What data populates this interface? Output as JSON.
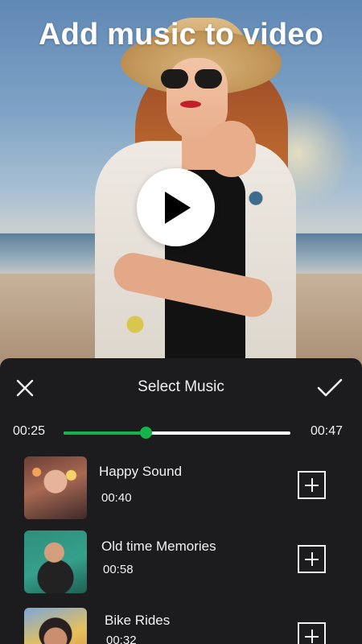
{
  "video_preview": {
    "headline": "Add music to video",
    "play_icon": "play-icon"
  },
  "music_sheet": {
    "title": "Select Music",
    "close_icon": "close-icon",
    "confirm_icon": "checkmark-icon",
    "timeline": {
      "start_time": "00:25",
      "end_time": "00:47",
      "progress_fraction": 0.36,
      "accent_color": "#17b34a"
    },
    "tracks": [
      {
        "title": "Happy Sound",
        "duration": "00:40",
        "add_icon": "plus-icon"
      },
      {
        "title": "Old time Memories",
        "duration": "00:58",
        "add_icon": "plus-icon"
      },
      {
        "title": "Bike Rides",
        "duration": "00:32",
        "add_icon": "plus-icon"
      }
    ]
  }
}
